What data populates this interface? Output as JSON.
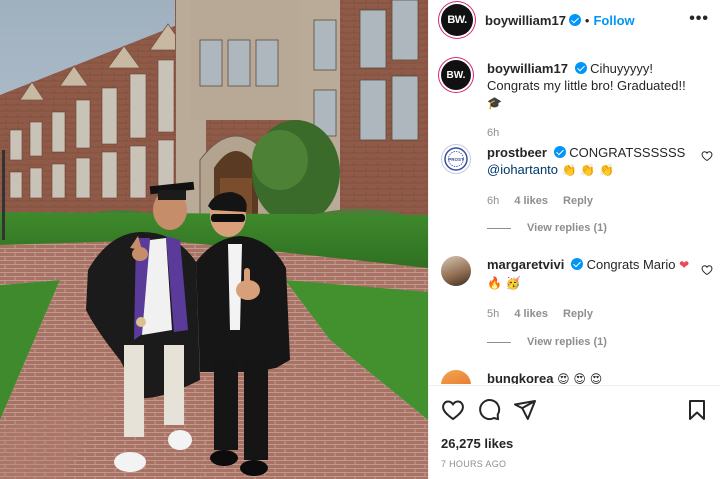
{
  "post": {
    "username": "boywilliam17",
    "avatar_text": "BW.",
    "follow_label": "Follow",
    "dot": "•",
    "more_label": "•••"
  },
  "caption": {
    "username": "boywilliam17",
    "text": "Cihuyyyyy! Congrats my little bro! Graduated!!",
    "emoji": "🎓",
    "time": "6h"
  },
  "comments": [
    {
      "username": "prostbeer",
      "text": "CONGRATSSSSSS",
      "mention": "@iohartanto",
      "emoji": "👏 👏 👏",
      "time": "6h",
      "likes": "4 likes",
      "reply": "Reply",
      "view_replies": "View replies (1)",
      "avatar_text": "PROST"
    },
    {
      "username": "margaretvivi",
      "text": "Congrats Mario",
      "emoji": "❤",
      "emoji2": "🔥 🥳",
      "time": "5h",
      "likes": "4 likes",
      "reply": "Reply",
      "view_replies": "View replies (1)"
    },
    {
      "username": "bungkorea",
      "emoji": "😍 😍 😍"
    }
  ],
  "footer": {
    "likes": "26,275 likes",
    "time_ago": "7 HOURS AGO"
  },
  "icons": {
    "like": "heart-icon",
    "comment": "comment-icon",
    "share": "send-icon",
    "save": "bookmark-icon"
  },
  "colors": {
    "accent": "#0095f6",
    "text": "#262626",
    "muted": "#8e8e8e",
    "heart": "#ed4956"
  }
}
